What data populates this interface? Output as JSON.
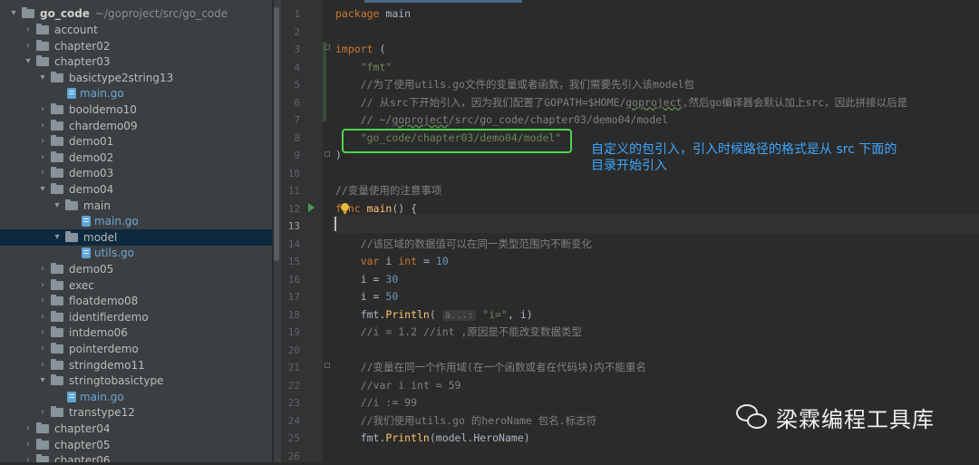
{
  "project_tree": {
    "root": {
      "name": "go_code",
      "path": "~/goproject/src/go_code"
    },
    "items": [
      {
        "label": "account",
        "depth": 1,
        "kind": "folder",
        "expanded": false
      },
      {
        "label": "chapter02",
        "depth": 1,
        "kind": "folder",
        "expanded": false
      },
      {
        "label": "chapter03",
        "depth": 1,
        "kind": "folder",
        "expanded": true
      },
      {
        "label": "basictype2string13",
        "depth": 2,
        "kind": "folder",
        "expanded": true
      },
      {
        "label": "main.go",
        "depth": 3,
        "kind": "gofile"
      },
      {
        "label": "booldemo10",
        "depth": 2,
        "kind": "folder",
        "expanded": false
      },
      {
        "label": "chardemo09",
        "depth": 2,
        "kind": "folder",
        "expanded": false
      },
      {
        "label": "demo01",
        "depth": 2,
        "kind": "folder",
        "expanded": false
      },
      {
        "label": "demo02",
        "depth": 2,
        "kind": "folder",
        "expanded": false
      },
      {
        "label": "demo03",
        "depth": 2,
        "kind": "folder",
        "expanded": false
      },
      {
        "label": "demo04",
        "depth": 2,
        "kind": "folder",
        "expanded": true
      },
      {
        "label": "main",
        "depth": 3,
        "kind": "folder",
        "expanded": true
      },
      {
        "label": "main.go",
        "depth": 4,
        "kind": "gofile"
      },
      {
        "label": "model",
        "depth": 3,
        "kind": "folder",
        "expanded": true,
        "selected": true
      },
      {
        "label": "utils.go",
        "depth": 4,
        "kind": "gofile"
      },
      {
        "label": "demo05",
        "depth": 2,
        "kind": "folder",
        "expanded": false
      },
      {
        "label": "exec",
        "depth": 2,
        "kind": "folder",
        "expanded": false
      },
      {
        "label": "floatdemo08",
        "depth": 2,
        "kind": "folder",
        "expanded": false
      },
      {
        "label": "identifierdemo",
        "depth": 2,
        "kind": "folder",
        "expanded": false
      },
      {
        "label": "intdemo06",
        "depth": 2,
        "kind": "folder",
        "expanded": false
      },
      {
        "label": "pointerdemo",
        "depth": 2,
        "kind": "folder",
        "expanded": false
      },
      {
        "label": "stringdemo11",
        "depth": 2,
        "kind": "folder",
        "expanded": false
      },
      {
        "label": "stringtobasictype",
        "depth": 2,
        "kind": "folder",
        "expanded": true
      },
      {
        "label": "main.go",
        "depth": 3,
        "kind": "gofile"
      },
      {
        "label": "transtype12",
        "depth": 2,
        "kind": "folder",
        "expanded": false
      },
      {
        "label": "chapter04",
        "depth": 1,
        "kind": "folder",
        "expanded": false
      },
      {
        "label": "chapter05",
        "depth": 1,
        "kind": "folder",
        "expanded": false
      },
      {
        "label": "chapter06",
        "depth": 1,
        "kind": "folder",
        "expanded": false
      }
    ]
  },
  "editor": {
    "current_line": 13,
    "lines": [
      {
        "n": "1",
        "tokens": [
          [
            "kw",
            "package "
          ],
          [
            "plain",
            "main"
          ]
        ]
      },
      {
        "n": "2",
        "tokens": []
      },
      {
        "n": "3",
        "tokens": [
          [
            "kw",
            "import "
          ],
          [
            "plain",
            "("
          ]
        ]
      },
      {
        "n": "4",
        "tokens": [
          [
            "plain",
            "    "
          ],
          [
            "str",
            "\"fmt\""
          ]
        ]
      },
      {
        "n": "5",
        "tokens": [
          [
            "plain",
            "    "
          ],
          [
            "cm",
            "//为了使用utils.go文件的变量或者函数，我们需要先引入该model包"
          ]
        ]
      },
      {
        "n": "6",
        "tokens": [
          [
            "plain",
            "    "
          ],
          [
            "cm",
            "// 从src下开始引入，因为我们配置了GOPATH=$HOME/"
          ],
          [
            "cmu",
            "goproject"
          ],
          [
            "cm",
            ",然后go编译器会默认加上src，因此拼接以后是"
          ]
        ]
      },
      {
        "n": "7",
        "tokens": [
          [
            "plain",
            "    "
          ],
          [
            "cm",
            "// ~/"
          ],
          [
            "cmu",
            "goproject"
          ],
          [
            "cm",
            "/src/go_code/chapter03/demo04/model"
          ]
        ]
      },
      {
        "n": "8",
        "tokens": [
          [
            "plain",
            "    "
          ],
          [
            "str",
            "\"go_code/chapter03/demo04/model\""
          ]
        ]
      },
      {
        "n": "9",
        "tokens": [
          [
            "plain",
            ")"
          ]
        ]
      },
      {
        "n": "10",
        "tokens": []
      },
      {
        "n": "11",
        "tokens": [
          [
            "cm",
            "//变量使用的注意事项"
          ]
        ]
      },
      {
        "n": "12",
        "tokens": [
          [
            "kw",
            "func "
          ],
          [
            "fn",
            "main"
          ],
          [
            "plain",
            "() {"
          ]
        ]
      },
      {
        "n": "13",
        "tokens": []
      },
      {
        "n": "14",
        "tokens": [
          [
            "plain",
            "    "
          ],
          [
            "cm",
            "//该区域的数据值可以在同一类型范围内不断变化"
          ]
        ]
      },
      {
        "n": "15",
        "tokens": [
          [
            "plain",
            "    "
          ],
          [
            "kw",
            "var "
          ],
          [
            "plain",
            "i "
          ],
          [
            "kw",
            "int "
          ],
          [
            "plain",
            "= "
          ],
          [
            "num",
            "10"
          ]
        ]
      },
      {
        "n": "16",
        "tokens": [
          [
            "plain",
            "    i = "
          ],
          [
            "num",
            "30"
          ]
        ]
      },
      {
        "n": "17",
        "tokens": [
          [
            "plain",
            "    i = "
          ],
          [
            "num",
            "50"
          ]
        ]
      },
      {
        "n": "18",
        "tokens": [
          [
            "plain",
            "    fmt."
          ],
          [
            "fn",
            "Println"
          ],
          [
            "plain",
            "( "
          ],
          [
            "hint",
            "a...:"
          ],
          [
            "plain",
            " "
          ],
          [
            "str",
            "\"i=\""
          ],
          [
            "plain",
            ", i)"
          ]
        ]
      },
      {
        "n": "19",
        "tokens": [
          [
            "plain",
            "    "
          ],
          [
            "cm",
            "//i = 1.2 //int ,原因是不能改变数据类型"
          ]
        ]
      },
      {
        "n": "20",
        "tokens": []
      },
      {
        "n": "21",
        "tokens": [
          [
            "plain",
            "    "
          ],
          [
            "cm",
            "//变量在同一个作用域(在一个函数或者在代码块)内不能重名"
          ]
        ]
      },
      {
        "n": "22",
        "tokens": [
          [
            "plain",
            "    "
          ],
          [
            "cm",
            "//var i int = 59"
          ]
        ]
      },
      {
        "n": "23",
        "tokens": [
          [
            "plain",
            "    "
          ],
          [
            "cm",
            "//i := 99"
          ]
        ]
      },
      {
        "n": "24",
        "tokens": [
          [
            "plain",
            "    "
          ],
          [
            "cm",
            "//我们使用utils.go 的heroName 包名.标志符"
          ]
        ]
      },
      {
        "n": "25",
        "tokens": [
          [
            "plain",
            "    fmt."
          ],
          [
            "fn",
            "Println"
          ],
          [
            "plain",
            "(model.HeroName)"
          ]
        ]
      },
      {
        "n": "26",
        "tokens": []
      }
    ]
  },
  "annotation": {
    "line1": "自定义的包引入，引入时候路径的格式是从 src 下面的",
    "line2": "目录开始引入"
  },
  "watermark": {
    "text": "梁霖编程工具库"
  },
  "colors": {
    "annotation_text": "#3da7ff",
    "highlight_box": "#4cd64c",
    "keyword": "#cc7832",
    "string": "#6a8759",
    "comment": "#808080",
    "number": "#6897bb",
    "function": "#ffc66d"
  }
}
